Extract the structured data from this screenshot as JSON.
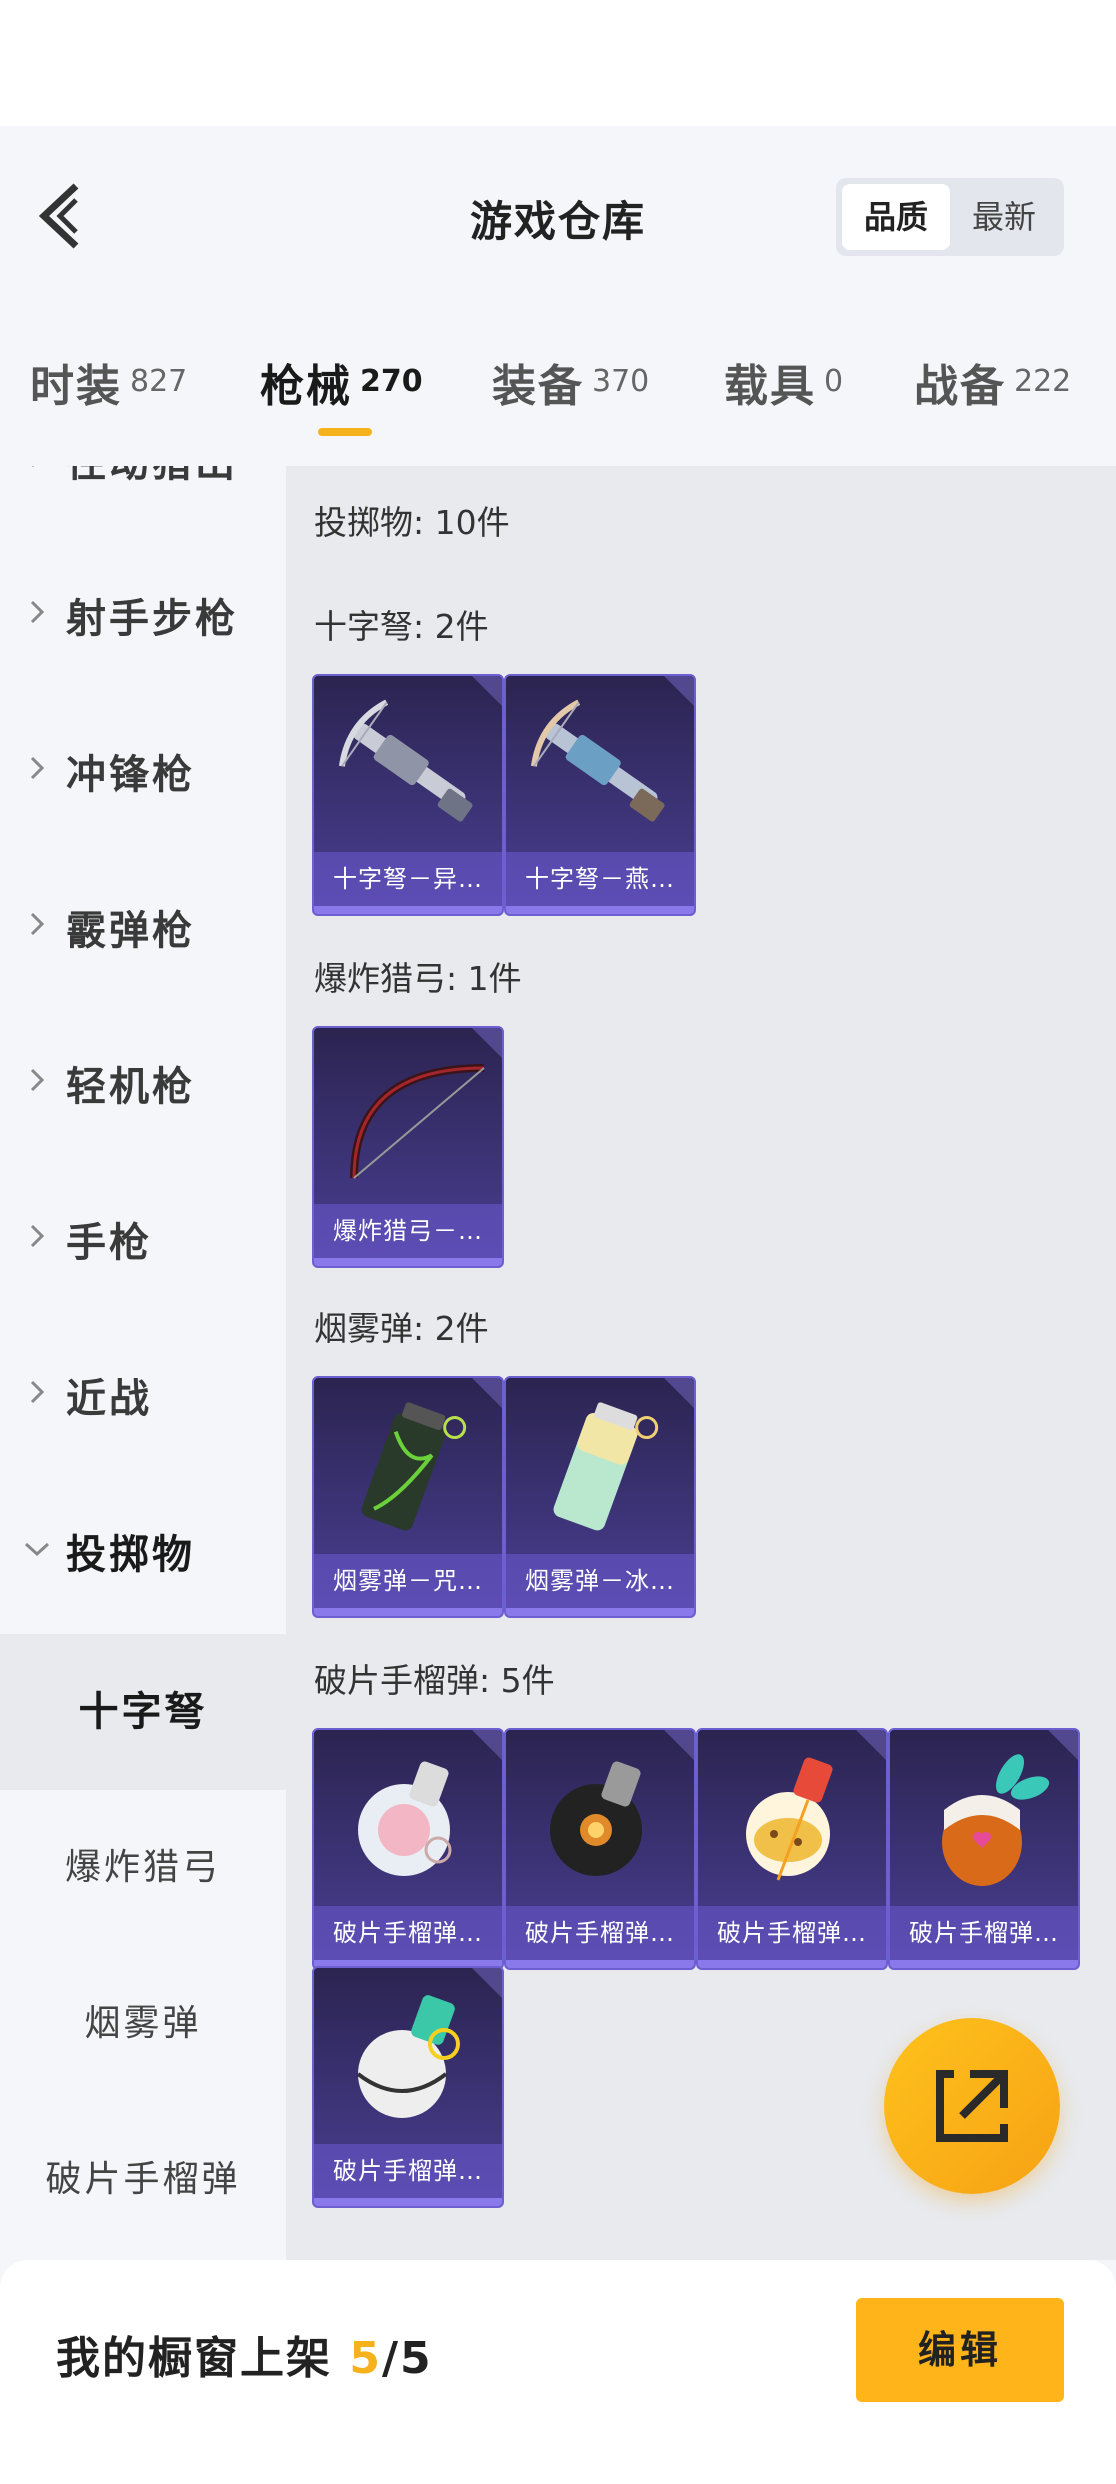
{
  "header": {
    "title": "游戏仓库",
    "sort": {
      "quality": "品质",
      "newest": "最新",
      "selected": "品质"
    }
  },
  "tabs": [
    {
      "label": "时装",
      "count": "827"
    },
    {
      "label": "枪械",
      "count": "270",
      "active": true
    },
    {
      "label": "装备",
      "count": "370"
    },
    {
      "label": "载具",
      "count": "0"
    },
    {
      "label": "战备",
      "count": "222"
    }
  ],
  "sidebar": {
    "partial": "径动猎出",
    "categories": [
      "射手步枪",
      "冲锋枪",
      "霰弹枪",
      "轻机枪",
      "手枪",
      "近战",
      "投掷物"
    ],
    "subs": [
      "十字弩",
      "爆炸猎弓",
      "烟雾弹",
      "破片手榴弹"
    ],
    "selected_sub": "十字弩"
  },
  "content": {
    "summary": "投掷物: 10件",
    "sections": [
      {
        "title": "十字弩: 2件",
        "items": [
          {
            "label": "十字弩－异…",
            "icon": "crossbow-silver"
          },
          {
            "label": "十字弩－燕…",
            "icon": "crossbow-blue"
          }
        ]
      },
      {
        "title": "爆炸猎弓: 1件",
        "items": [
          {
            "label": "爆炸猎弓－…",
            "icon": "bow-red"
          }
        ]
      },
      {
        "title": "烟雾弹: 2件",
        "items": [
          {
            "label": "烟雾弹－咒…",
            "icon": "smoke-green"
          },
          {
            "label": "烟雾弹－冰…",
            "icon": "smoke-mint"
          }
        ]
      },
      {
        "title": "破片手榴弹: 5件",
        "items": [
          {
            "label": "破片手榴弹…",
            "icon": "grenade-pink"
          },
          {
            "label": "破片手榴弹…",
            "icon": "grenade-black"
          },
          {
            "label": "破片手榴弹…",
            "icon": "grenade-yellow"
          },
          {
            "label": "破片手榴弹…",
            "icon": "grenade-strawberry"
          },
          {
            "label": "破片手榴弹…",
            "icon": "grenade-white"
          }
        ]
      }
    ]
  },
  "footer": {
    "label": "我的橱窗上架",
    "current": "5",
    "total": "/5",
    "edit": "编辑"
  },
  "colors": {
    "accent": "#f5b21c",
    "card": "#3c3376",
    "card_border": "#6c5fd0"
  }
}
